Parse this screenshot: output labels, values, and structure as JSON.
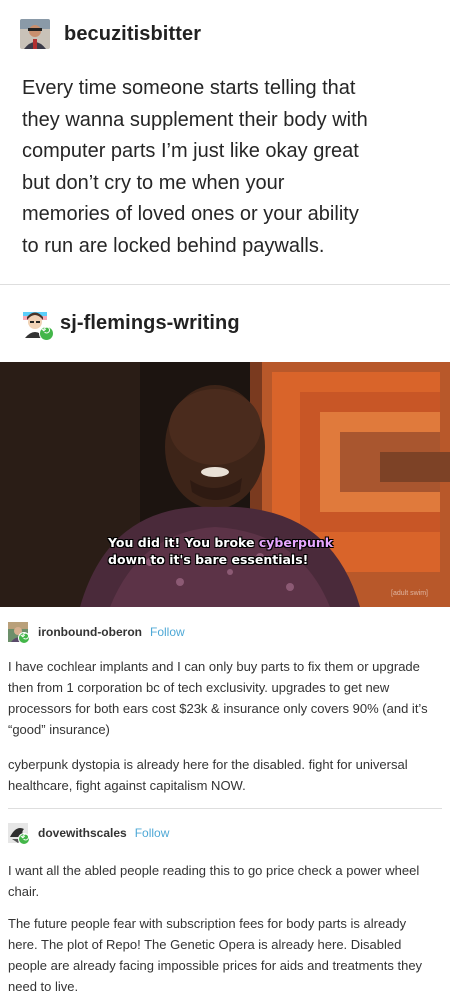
{
  "post": {
    "username": "becuzitisbitter",
    "text": "Every time someone starts telling that\nthey wanna supplement their body with\ncomputer parts I’m just like okay great\nbut don’t cry to me when your\nmemories of loved ones or your ability\nto run are locked behind paywalls."
  },
  "reblog1": {
    "username": "sj-flemings-writing",
    "meme_caption_part1": "You did it! You broke ",
    "meme_caption_highlight": "cyberpunk",
    "meme_caption_part2": "down to it's bare essentials!",
    "watermark": "[adult swim]"
  },
  "reblog2": {
    "username": "ironbound-oberon",
    "follow_label": "Follow",
    "paragraph1": "I have cochlear implants and I can only buy parts to fix them or upgrade then from 1 corporation bc of tech exclusivity. upgrades to get new processors for both ears cost $23k & insurance only covers 90% (and it’s “good” insurance)",
    "paragraph2": "cyberpunk dystopia is already here for the disabled. fight for universal healthcare, fight against capitalism NOW."
  },
  "reblog3": {
    "username": "dovewithscales",
    "follow_label": "Follow",
    "paragraph1": "I want all the abled people reading this to go price check a power wheel chair.",
    "paragraph2": "The future people fear with subscription fees for body parts is already here. The plot of Repo! The Genetic Opera is already here. Disabled people are already facing impossible prices for aids and treatments they need to live."
  },
  "colors": {
    "follow_blue": "#4ea8d6",
    "reblog_green": "#43b649",
    "caption_highlight": "#e7a7ff"
  }
}
